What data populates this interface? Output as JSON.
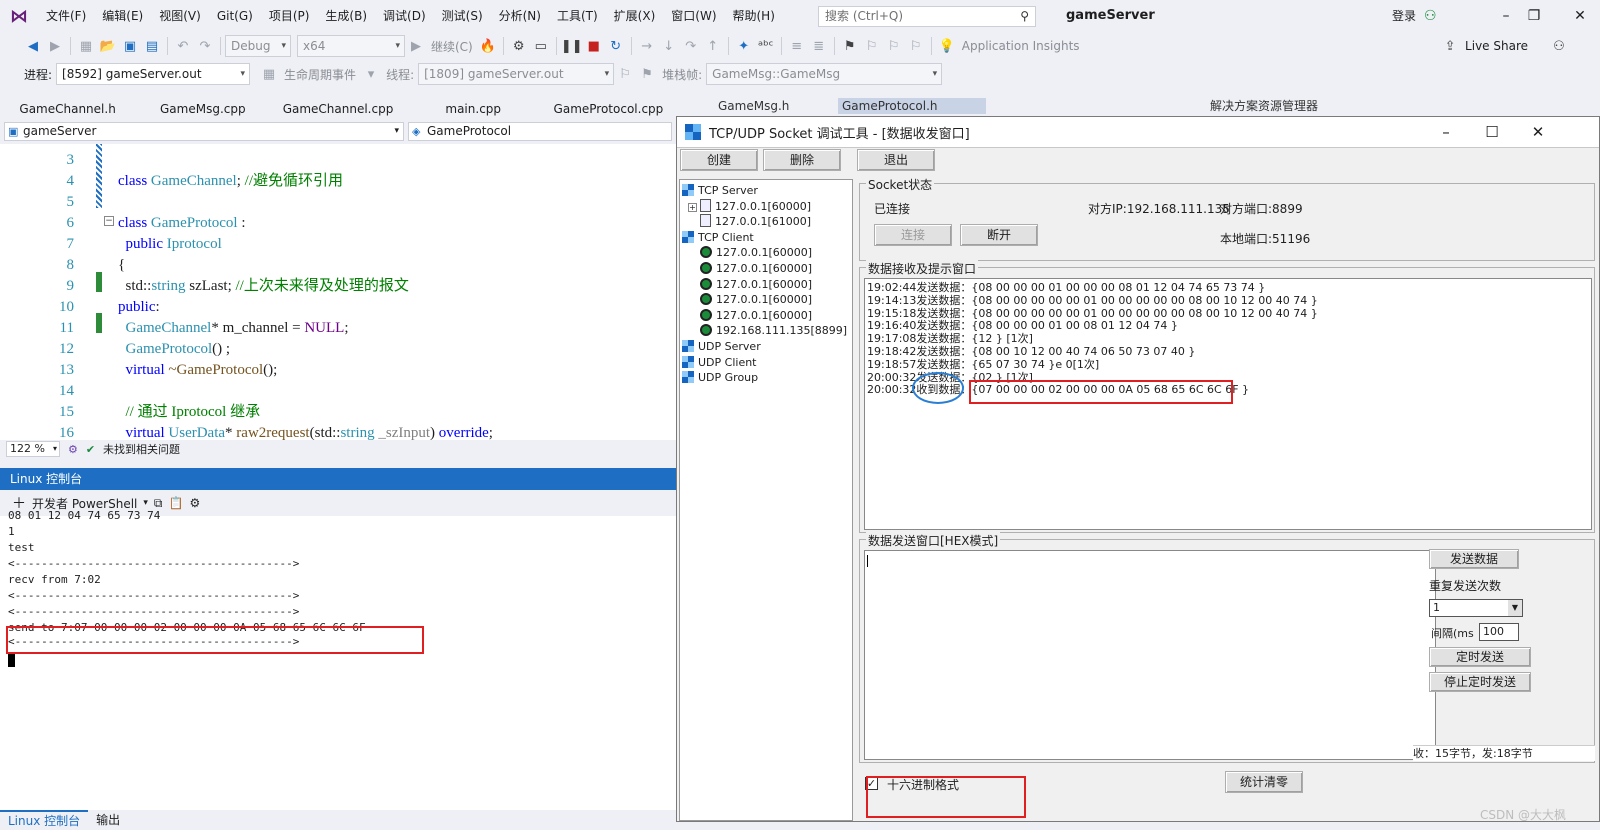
{
  "menubar": {
    "items": [
      "文件(F)",
      "编辑(E)",
      "视图(V)",
      "Git(G)",
      "项目(P)",
      "生成(B)",
      "调试(D)",
      "测试(S)",
      "分析(N)",
      "工具(T)",
      "扩展(X)",
      "窗口(W)",
      "帮助(H)"
    ],
    "search_placeholder": "搜索 (Ctrl+Q)",
    "solution_title": "gameServer",
    "login": "登录"
  },
  "toolbar": {
    "config": "Debug",
    "platform": "x64",
    "continue_label": "继续(C)",
    "insights": "Application Insights",
    "live_share": "Live Share",
    "process_label": "进程:",
    "process_value": "[8592] gameServer.out",
    "lifecycle_label": "生命周期事件",
    "thread_label": "线程:",
    "thread_value": "[1809] gameServer.out",
    "stack_label": "堆栈帧:",
    "stack_value": "GameMsg::GameMsg"
  },
  "doc_tabs": [
    "GameChannel.h",
    "GameMsg.cpp",
    "GameChannel.cpp",
    "main.cpp",
    "GameProtocol.cpp"
  ],
  "bg_tabs": {
    "a": "GameMsg.h",
    "b": "GameProtocol.h",
    "panel": "解决方案资源管理器"
  },
  "editor": {
    "nav_left": "gameServer",
    "nav_right": "GameProtocol",
    "zoom": "122 %",
    "status": "未找到相关问题",
    "lines": [
      {
        "n": "3",
        "segments": []
      },
      {
        "n": "4",
        "segments": [
          {
            "t": "class ",
            "c": "kw"
          },
          {
            "t": "GameChannel",
            "c": "ty"
          },
          {
            "t": "; ",
            "c": ""
          },
          {
            "t": "//避免循环引用",
            "c": "cm"
          }
        ]
      },
      {
        "n": "5",
        "segments": []
      },
      {
        "n": "6",
        "segments": [
          {
            "t": "class ",
            "c": "kw"
          },
          {
            "t": "GameProtocol",
            "c": "ty"
          },
          {
            "t": " :",
            "c": ""
          }
        ]
      },
      {
        "n": "7",
        "segments": [
          {
            "t": "  public ",
            "c": "kw"
          },
          {
            "t": "Iprotocol",
            "c": "ty"
          }
        ]
      },
      {
        "n": "8",
        "segments": [
          {
            "t": "{",
            "c": ""
          }
        ]
      },
      {
        "n": "9",
        "segments": [
          {
            "t": "  std::",
            "c": ""
          },
          {
            "t": "string",
            "c": "ty"
          },
          {
            "t": " szLast; ",
            "c": ""
          },
          {
            "t": "//上次未来得及处理的报文",
            "c": "cm"
          }
        ]
      },
      {
        "n": "10",
        "segments": [
          {
            "t": "public",
            "c": "kw"
          },
          {
            "t": ":",
            "c": ""
          }
        ]
      },
      {
        "n": "11",
        "segments": [
          {
            "t": "  GameChannel",
            "c": "ty"
          },
          {
            "t": "* m_channel = ",
            "c": ""
          },
          {
            "t": "NULL",
            "c": "mac"
          },
          {
            "t": ";",
            "c": ""
          }
        ]
      },
      {
        "n": "12",
        "segments": [
          {
            "t": "  GameProtocol",
            "c": "ty"
          },
          {
            "t": "() ;",
            "c": ""
          }
        ]
      },
      {
        "n": "13",
        "segments": [
          {
            "t": "  virtual ",
            "c": "kw"
          },
          {
            "t": "~GameProtocol",
            "c": "fn"
          },
          {
            "t": "();",
            "c": ""
          }
        ]
      },
      {
        "n": "14",
        "segments": []
      },
      {
        "n": "15",
        "segments": [
          {
            "t": "  // 通过 Iprotocol 继承",
            "c": "cm"
          }
        ]
      },
      {
        "n": "16",
        "segments": [
          {
            "t": "  virtual ",
            "c": "kw"
          },
          {
            "t": "UserData",
            "c": "ty"
          },
          {
            "t": "* ",
            "c": ""
          },
          {
            "t": "raw2request",
            "c": "fn"
          },
          {
            "t": "(std::",
            "c": ""
          },
          {
            "t": "string",
            "c": "ty"
          },
          {
            "t": " _szInput",
            "c": "pr"
          },
          {
            "t": ") ",
            "c": ""
          },
          {
            "t": "override",
            "c": "kw"
          },
          {
            "t": ";",
            "c": ""
          }
        ]
      }
    ]
  },
  "console": {
    "title": "Linux 控制台",
    "shell": "开发者 PowerShell",
    "lines": [
      "08 01 12 04 74 65 73 74",
      "1",
      "test",
      "<------------------------------------------>",
      "recv from 7:02",
      "<------------------------------------------>",
      "<------------------------------------------>",
      "send to 7:07 00 00 00 02 00 00 00 0A 05 68 65 6C 6C 6F",
      "<------------------------------------------>"
    ],
    "tab_active": "Linux 控制台",
    "tab_other": "输出"
  },
  "tool": {
    "title": "TCP/UDP Socket 调试工具 - [数据收发窗口]",
    "buttons": {
      "create": "创建",
      "delete": "删除",
      "exit": "退出"
    },
    "tree": [
      {
        "label": "TCP Server",
        "kind": "group",
        "indent": 0
      },
      {
        "label": "127.0.0.1[60000]",
        "kind": "doc",
        "indent": 1
      },
      {
        "label": "127.0.0.1[61000]",
        "kind": "doc",
        "indent": 1
      },
      {
        "label": "TCP Client",
        "kind": "group",
        "indent": 0
      },
      {
        "label": "127.0.0.1[60000]",
        "kind": "conn",
        "indent": 1
      },
      {
        "label": "127.0.0.1[60000]",
        "kind": "conn",
        "indent": 1
      },
      {
        "label": "127.0.0.1[60000]",
        "kind": "conn",
        "indent": 1
      },
      {
        "label": "127.0.0.1[60000]",
        "kind": "conn",
        "indent": 1
      },
      {
        "label": "127.0.0.1[60000]",
        "kind": "conn",
        "indent": 1
      },
      {
        "label": "192.168.111.135[8899]",
        "kind": "conn",
        "indent": 1
      },
      {
        "label": "UDP Server",
        "kind": "group",
        "indent": 0
      },
      {
        "label": "UDP Client",
        "kind": "group",
        "indent": 0
      },
      {
        "label": "UDP Group",
        "kind": "group",
        "indent": 0
      }
    ],
    "socket_status": {
      "title": "Socket状态",
      "state": "已连接",
      "peer_ip": "对方IP:192.168.111.135",
      "peer_port": "对方端口:8899",
      "local_port": "本地端口:51196",
      "connect_btn": "连接",
      "disconnect_btn": "断开"
    },
    "recv": {
      "title": "数据接收及提示窗口",
      "lines": [
        "19:02:44发送数据：{08 00 00 00 01 00 00 00 08 01 12 04 74 65 73 74 }",
        "19:14:13发送数据：{08 00 00 00 00 00 01 00 00 00 00 00 08 00 10 12 00 40 74 }",
        "19:15:18发送数据：{08 00 00 00 00 00 01 00 00 00 00 00 08 00 10 12 00 40 74 }",
        "19:16:40发送数据：{08 00 00 00 01 00 08 01 12 04 74 }",
        "19:17:08发送数据：{12 } [1次]",
        "19:18:42发送数据：{08 00 10 12 00 40 74 06 50 73 07 40 }",
        "19:18:57发送数据：{65 07 30 74 }e 0[1次]",
        "20:00:32发送数据：{02 } [1次]",
        "20:00:32收到数据：{07 00 00 00 02 00 00 00 0A 05 68 65 6C 6C 6F }"
      ]
    },
    "send": {
      "title": "数据发送窗口[HEX模式]",
      "send_btn": "发送数据",
      "repeat_label": "重复发送次数",
      "repeat_value": "1",
      "interval_label": "间隔(ms",
      "interval_value": "100",
      "timer_btn": "定时发送",
      "stop_timer_btn": "停止定时发送",
      "stats": "收：15字节，发:18字节"
    },
    "hex_label": "十六进制格式",
    "clear_btn": "统计清零"
  },
  "watermark": "CSDN @大大枫"
}
